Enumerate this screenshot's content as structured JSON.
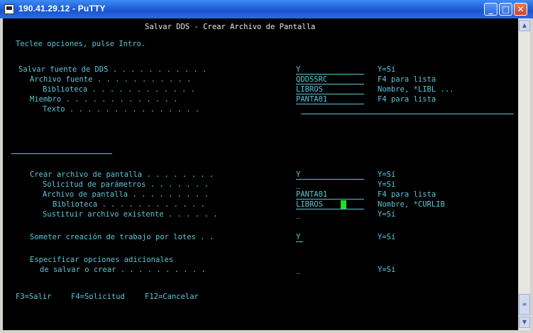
{
  "window": {
    "title": "190.41.29.12 - PuTTY",
    "minimize": "_",
    "maximize": "□",
    "close": "✕"
  },
  "terminal": {
    "header": "Salvar DDS - Crear Archivo de Pantalla",
    "instructions": "Teclee opciones, pulse Intro.",
    "rows": [
      {
        "label": "Salvar fuente de DDS . . . . . . . . . . .",
        "value": "Y",
        "hint": "Y=Sí"
      },
      {
        "label": "Archivo fuente . . . . . . . . . . .",
        "value": "QDDSSRC",
        "hint": "F4 para lista"
      },
      {
        "label": "Biblioteca . . . . . . . . . . . .",
        "value": "LIBROS",
        "hint": "Nombre, *LIBL ..."
      },
      {
        "label": "Miembro . . . . . . . . . . . . .",
        "value": "PANTA01",
        "hint": "F4 para lista"
      },
      {
        "label": "Texto . . . . . . . . . . . . . . .",
        "value": "",
        "hint": ""
      },
      {
        "label": "Crear archivo de pantalla . . . . . . . .",
        "value": "Y",
        "hint": "Y=Sí"
      },
      {
        "label": "Solicitud de parámetros . . . . . . .",
        "value": "_",
        "hint": "Y=Sí"
      },
      {
        "label": "Archivo de pantalla . . . . . . . . .",
        "value": "PANTA01",
        "hint": "F4 para lista"
      },
      {
        "label": "Biblioteca . . . . . . . . . . . .",
        "value": "LIBROS",
        "hint": "Nombre, *CURLIB"
      },
      {
        "label": "Sustituir archivo existente . . . . . .",
        "value": "_",
        "hint": "Y=Sí"
      },
      {
        "label": "Someter creación de trabajo por lotes . .",
        "value": "Y",
        "hint": "Y=Sí"
      },
      {
        "label": "Especificar opciones adicionales",
        "value": "",
        "hint": ""
      },
      {
        "label": "de salvar o crear . . . . . . . . . .",
        "value": "_",
        "hint": "Y=Sí"
      }
    ],
    "fkeys": [
      "F3=Salir",
      "F4=Solicitud",
      "F12=Cancelar"
    ]
  }
}
